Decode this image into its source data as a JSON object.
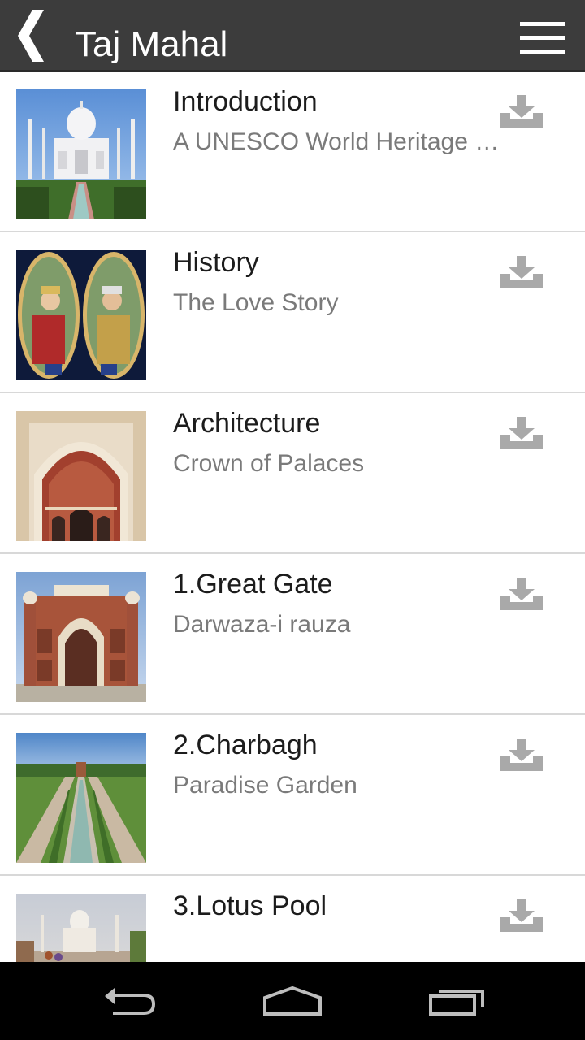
{
  "app_bar": {
    "title": "Taj Mahal",
    "back_icon": "chevron-left-icon",
    "menu_icon": "hamburger-menu-icon",
    "background": "#3c3c3c"
  },
  "items": [
    {
      "title": "Introduction",
      "subtitle": "A UNESCO World Heritage …",
      "thumbnail": "taj-mahal-photo",
      "action_icon": "download-icon"
    },
    {
      "title": "History",
      "subtitle": "The Love Story",
      "thumbnail": "mughal-portraits-painting",
      "action_icon": "download-icon"
    },
    {
      "title": "Architecture",
      "subtitle": "Crown of Palaces",
      "thumbnail": "iwan-arch-photo",
      "action_icon": "download-icon"
    },
    {
      "title": "1.Great Gate",
      "subtitle": "Darwaza-i rauza",
      "thumbnail": "great-gate-photo",
      "action_icon": "download-icon"
    },
    {
      "title": "2.Charbagh",
      "subtitle": "Paradise Garden",
      "thumbnail": "charbagh-garden-photo",
      "action_icon": "download-icon"
    },
    {
      "title": "3.Lotus Pool",
      "subtitle": "",
      "thumbnail": "lotus-pool-photo",
      "action_icon": "download-icon"
    }
  ],
  "system_nav": {
    "back_icon": "nav-back-icon",
    "home_icon": "nav-home-icon",
    "recents_icon": "nav-recents-icon"
  },
  "colors": {
    "title_text": "#1c1c1c",
    "subtitle_text": "#7a7a7a",
    "download_icon": "#a9a9a9",
    "divider": "#d8d8d8"
  }
}
